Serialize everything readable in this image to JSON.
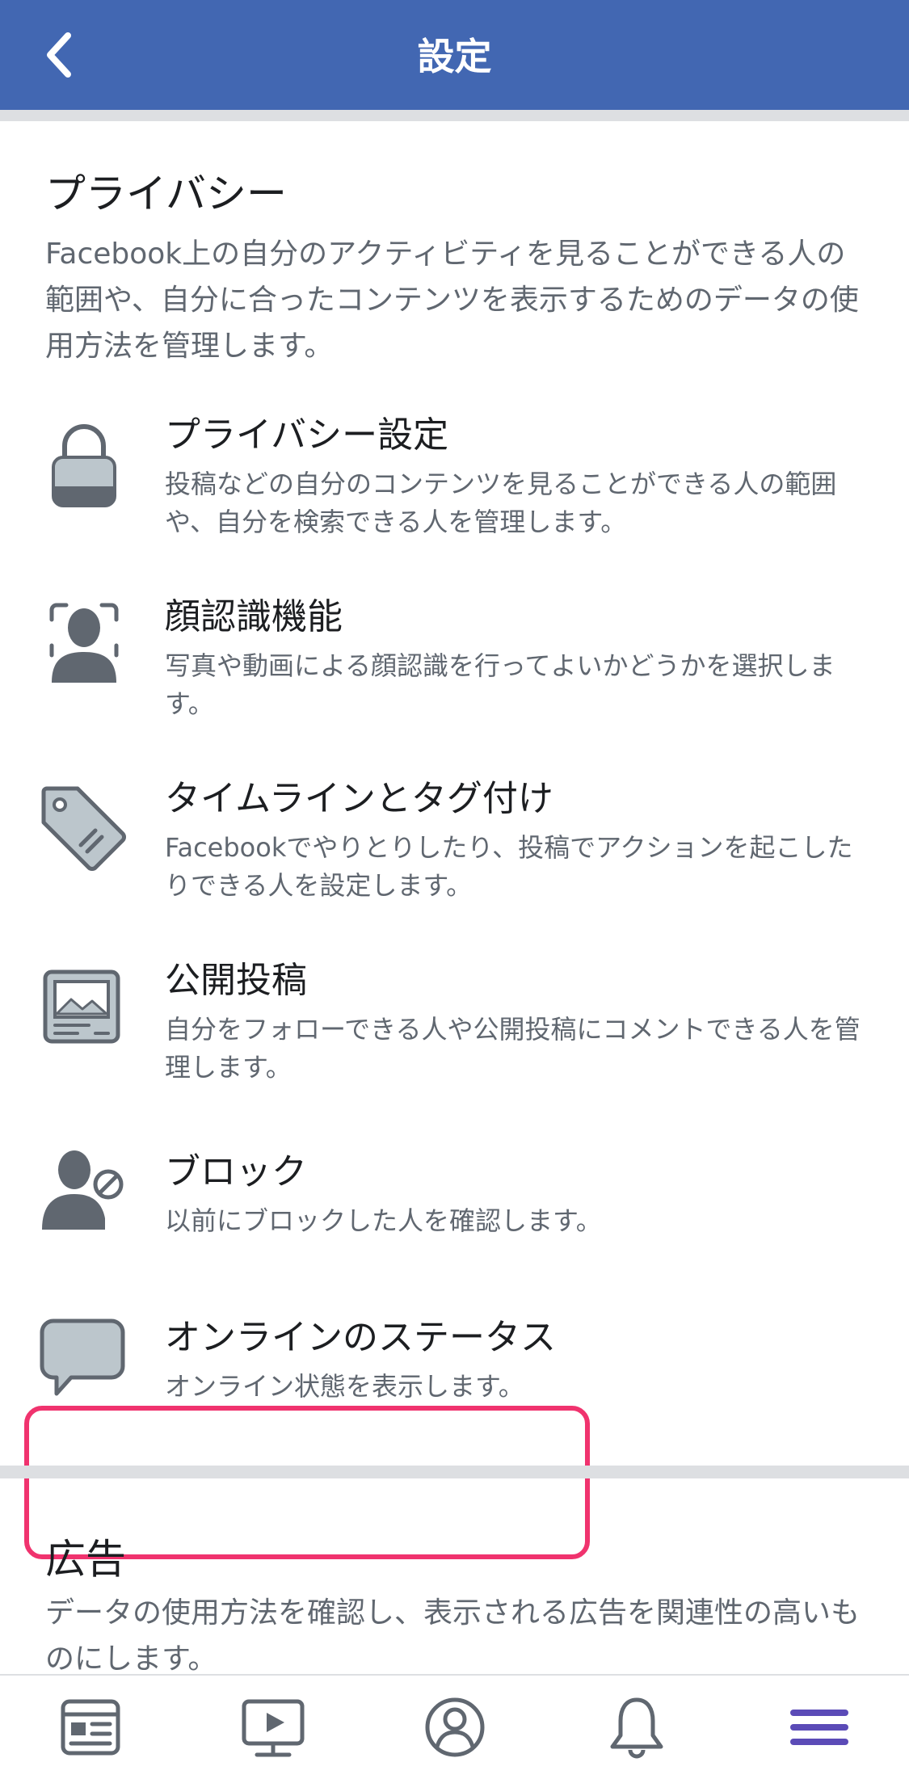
{
  "header": {
    "title": "設定",
    "back_icon": "chevron-left-icon"
  },
  "privacy": {
    "title": "プライバシー",
    "description": "Facebook上の自分のアクティビティを見ることができる人の範囲や、自分に合ったコンテンツを表示するためのデータの使用方法を管理します。",
    "items": [
      {
        "icon": "lock-icon",
        "label": "プライバシー設定",
        "sub": "投稿などの自分のコンテンツを見ることができる人の範囲や、自分を検索できる人を管理します。"
      },
      {
        "icon": "face-recognition-icon",
        "label": "顔認識機能",
        "sub": "写真や動画による顔認識を行ってよいかどうかを選択します。"
      },
      {
        "icon": "tag-icon",
        "label": "タイムラインとタグ付け",
        "sub": "Facebookでやりとりしたり、投稿でアクションを起こしたりできる人を設定します。"
      },
      {
        "icon": "public-post-icon",
        "label": "公開投稿",
        "sub": "自分をフォローできる人や公開投稿にコメントできる人を管理します。"
      },
      {
        "icon": "block-user-icon",
        "label": "ブロック",
        "sub": "以前にブロックした人を確認します。"
      },
      {
        "icon": "chat-bubble-icon",
        "label": "オンラインのステータス",
        "sub": "オンライン状態を表示します。"
      }
    ]
  },
  "ads": {
    "title": "広告",
    "description": "データの使用方法を確認し、表示される広告を関連性の高いものにします。"
  },
  "tabbar": {
    "tabs": [
      {
        "icon": "news-feed-icon"
      },
      {
        "icon": "video-icon"
      },
      {
        "icon": "profile-icon"
      },
      {
        "icon": "bell-icon"
      },
      {
        "icon": "menu-icon",
        "active": true
      }
    ]
  },
  "colors": {
    "header_bg": "#4267b2",
    "highlight": "#f0336e",
    "icon_gray": "#606770",
    "active_tab": "#5b4bb7"
  }
}
